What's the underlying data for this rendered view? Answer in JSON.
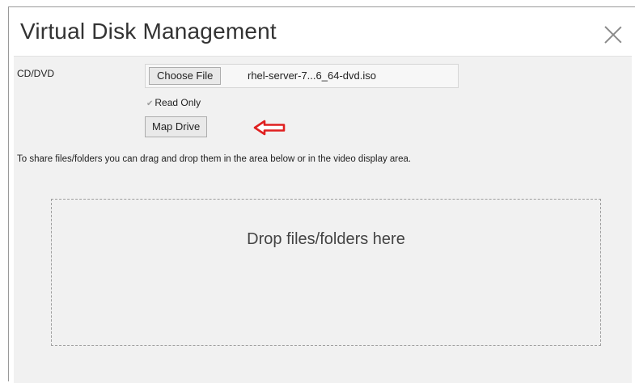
{
  "dialog": {
    "title": "Virtual Disk Management",
    "close_icon": "close-icon"
  },
  "cd_dvd": {
    "label": "CD/DVD",
    "choose_file_label": "Choose File",
    "file_name": "rhel-server-7...6_64-dvd.iso",
    "read_only_label": "Read Only",
    "read_only_checked": true,
    "map_drive_label": "Map Drive",
    "annotation_icon": "red-arrow-left-icon",
    "annotation_color": "#e02020"
  },
  "share": {
    "info_text": "To share files/folders you can drag and drop them in the area below or in the video display area.",
    "drop_text": "Drop files/folders here"
  }
}
